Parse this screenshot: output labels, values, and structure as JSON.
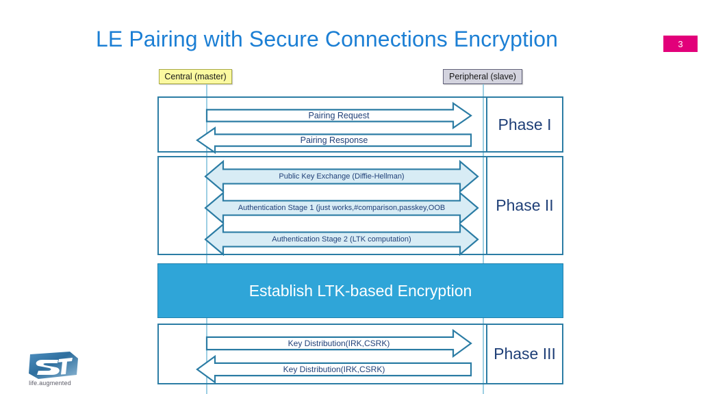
{
  "slide": {
    "title": "LE Pairing with Secure Connections Encryption",
    "page_number": "3",
    "title_color": "#1c7fd4",
    "badge_color": "#e2007a"
  },
  "roles": {
    "central": "Central (master)",
    "peripheral": "Peripheral (slave)"
  },
  "phases": [
    {
      "id": "phase1",
      "label": "Phase I",
      "messages": [
        {
          "text": "Pairing Request",
          "direction": "right",
          "fill": "#ffffff"
        },
        {
          "text": "Pairing Response",
          "direction": "left",
          "fill": "#ffffff"
        }
      ]
    },
    {
      "id": "phase2",
      "label": "Phase II",
      "messages": [
        {
          "text": "Public Key Exchange (Diffie-Hellman)",
          "direction": "both",
          "fill": "#d8ecf5"
        },
        {
          "text": "Authentication Stage 1 (just works,#comparison,passkey,OOB",
          "direction": "both",
          "fill": "#d8ecf5"
        },
        {
          "text": "Authentication Stage 2 (LTK computation)",
          "direction": "both",
          "fill": "#d8ecf5"
        }
      ]
    },
    {
      "id": "phase3",
      "label": "Phase III",
      "messages": [
        {
          "text": "Key Distribution(IRK,CSRK)",
          "direction": "right",
          "fill": "#ffffff"
        },
        {
          "text": "Key Distribution(IRK,CSRK)",
          "direction": "left",
          "fill": "#ffffff"
        }
      ]
    }
  ],
  "banner": {
    "text": "Establish LTK-based Encryption",
    "background": "#2fa5d8",
    "text_color": "#ffffff"
  },
  "logo": {
    "name": "st-logo",
    "tagline": "life.augmented"
  }
}
